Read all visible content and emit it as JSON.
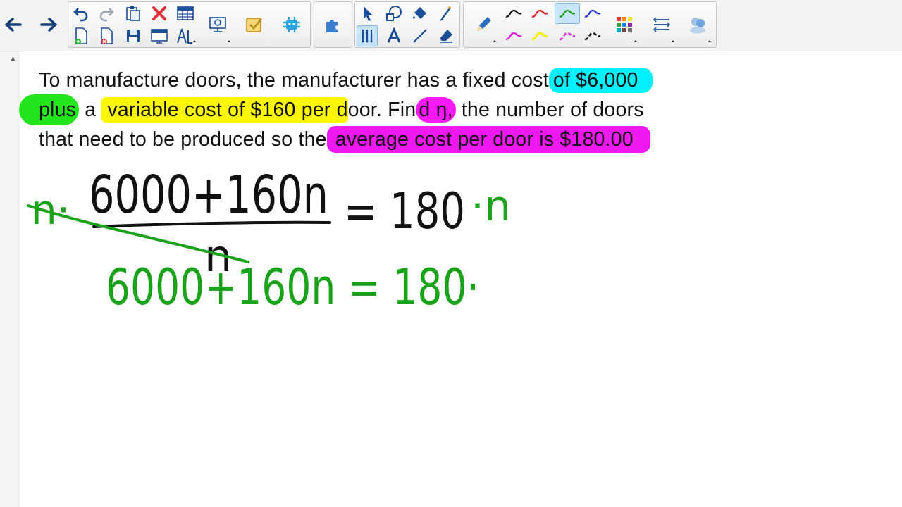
{
  "toolbar": {
    "pen_colors": [
      "#111111",
      "#e0141e",
      "#1aa21a",
      "#1b31d6",
      "#e018e0",
      "#f2f200",
      "#e018e0",
      "#111111"
    ],
    "icons": [
      "back-arrow-icon",
      "forward-arrow-icon",
      "undo-icon",
      "redo-icon",
      "paste-icon",
      "delete-icon",
      "table-icon",
      "new-page-icon",
      "delete-page-icon",
      "save-icon",
      "screen-shade-icon",
      "measurement-tools-icon",
      "document-camera-icon",
      "response-icon",
      "add-ons-icon",
      "select-icon",
      "shapes-icon",
      "fill-icon",
      "magic-pen-icon",
      "pen-icon",
      "text-icon",
      "line-icon",
      "eraser-icon",
      "pencil-icon",
      "color-palette-icon",
      "properties-icon",
      "user-icon"
    ]
  },
  "problem": {
    "line1_plain": "To manufacture doors, the manufacturer has a fixed cost",
    "line1_hl": "of $6,000",
    "line2_green": "plus",
    "line2_a": " a ",
    "line2_yellow": "variable cost of $160 per d",
    "line2_mid": "oor. Fin",
    "line2_magenta": "d ŋ,",
    "line2_end": " the number of doors",
    "line3_plain": "that need to be produced so the",
    "line3_hl": "average cost per door is $180.00"
  },
  "handwriting": {
    "eq1_numerator": "6000+160n",
    "eq1_denominator": "n",
    "eq1_rhs": "= 180",
    "eq1_mult": "·n",
    "eq1_left_mult": "n·",
    "eq2": "6000+160n = 180·",
    "ink_black": "#111111",
    "ink_green": "#1aa21a"
  }
}
